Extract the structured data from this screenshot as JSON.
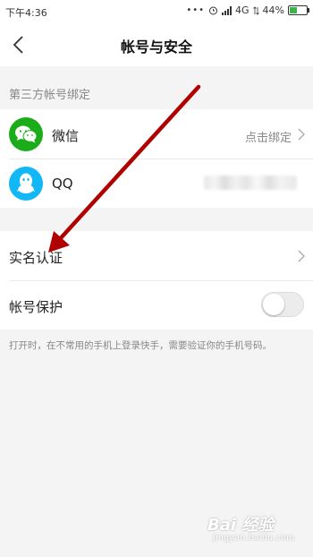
{
  "status_bar": {
    "time": "下午4:36",
    "dots": "•••",
    "network": "4G",
    "battery": "44%",
    "battery_level": 0.44
  },
  "nav": {
    "title": "帐号与安全"
  },
  "third_party": {
    "header": "第三方帐号绑定",
    "items": [
      {
        "icon": "wechat-icon",
        "label": "微信",
        "value": "点击绑定",
        "color": "#1aad19"
      },
      {
        "icon": "qq-icon",
        "label": "QQ",
        "value": "",
        "color": "#12b7f5"
      }
    ]
  },
  "real_name": {
    "label": "实名认证"
  },
  "protection": {
    "label": "帐号保护",
    "enabled": false,
    "hint": "打开时，在不常用的手机上登录快手，需要验证你的手机号码。"
  },
  "annotation": {
    "color": "#b00000"
  },
  "watermark": {
    "brand": "Bai 经验",
    "sub": "jingyan.baidu.com"
  }
}
